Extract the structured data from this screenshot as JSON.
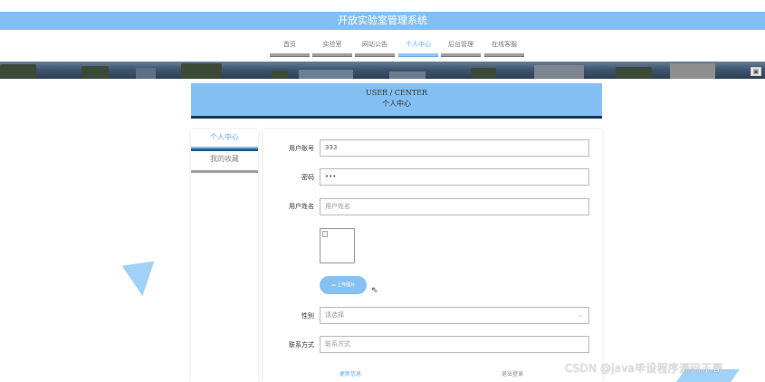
{
  "app": {
    "title": "开放实验室管理系统"
  },
  "nav": {
    "items": [
      {
        "label": "首页"
      },
      {
        "label": "实验室"
      },
      {
        "label": "网站公告"
      },
      {
        "label": "个人中心"
      },
      {
        "label": "后台管理"
      },
      {
        "label": "在线客服"
      }
    ],
    "active": "个人中心"
  },
  "center": {
    "title_en": "USER / CENTER",
    "title_zh": "个人中心"
  },
  "sidebar": {
    "items": [
      {
        "label": "个人中心"
      },
      {
        "label": "我的收藏"
      }
    ],
    "active": "个人中心"
  },
  "form": {
    "account": {
      "label": "用户账号",
      "value": "333"
    },
    "password": {
      "label": "密码",
      "value": "•••"
    },
    "name": {
      "label": "用户姓名",
      "placeholder": "用户姓名"
    },
    "upload": {
      "label": "上传图片"
    },
    "gender": {
      "label": "性别",
      "placeholder": "请选择"
    },
    "contact": {
      "label": "联系方式",
      "placeholder": "联系方式"
    },
    "update_label": "更新信息",
    "logout_label": "退出登录"
  },
  "watermark": "CSDN @java毕设程序源码王哥",
  "colors": {
    "accent": "#83bff2",
    "dark_line": "#123c5c",
    "link": "#5aa8ea"
  },
  "icons": {
    "upload": "cloud-upload-icon",
    "select": "chevron-down-icon",
    "cursor": "mouse-cursor-icon"
  }
}
